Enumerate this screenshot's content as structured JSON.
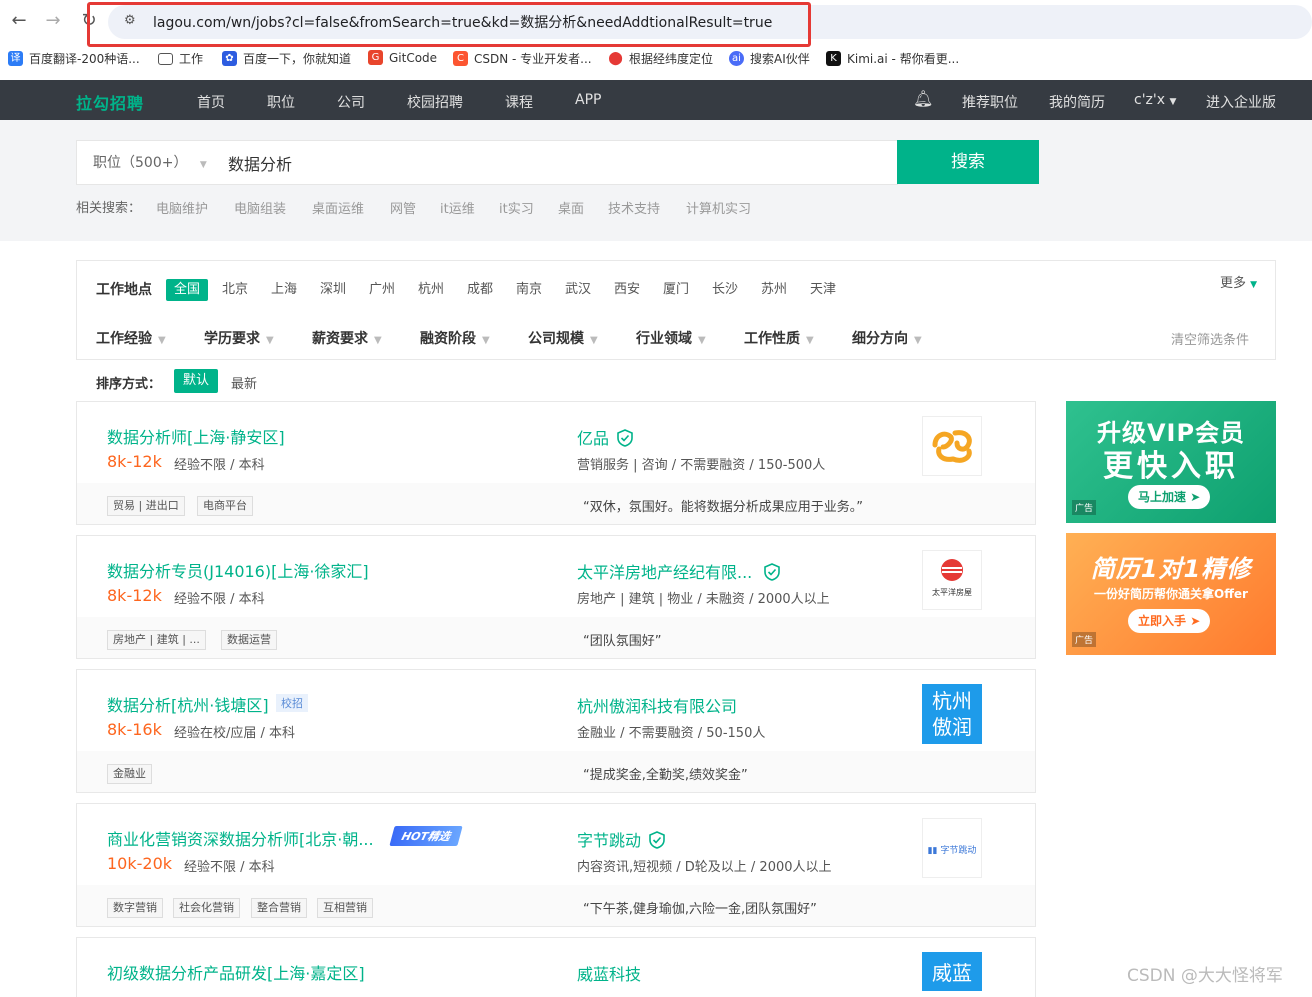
{
  "browser": {
    "url": "lagou.com/wn/jobs?cl=false&fromSearch=true&kd=数据分析&needAddtionalResult=true",
    "bookmarks": [
      "百度翻译-200种语...",
      "工作",
      "百度一下，你就知道",
      "GitCode",
      "CSDN - 专业开发者...",
      "根据经纬度定位",
      "搜索AI伙伴",
      "Kimi.ai - 帮你看更..."
    ]
  },
  "header": {
    "logo": "拉勾招聘",
    "nav": [
      "首页",
      "职位",
      "公司",
      "校园招聘",
      "课程",
      "APP"
    ],
    "right": [
      "推荐职位",
      "我的简历",
      "c'z'x",
      "进入企业版"
    ]
  },
  "search": {
    "category": "职位（500+）",
    "query": "数据分析",
    "button": "搜索",
    "related_label": "相关搜索：",
    "related": [
      "电脑维护",
      "电脑组装",
      "桌面运维",
      "网管",
      "it运维",
      "it实习",
      "桌面",
      "技术支持",
      "计算机实习"
    ]
  },
  "filters": {
    "location_label": "工作地点",
    "cities": [
      "全国",
      "北京",
      "上海",
      "深圳",
      "广州",
      "杭州",
      "成都",
      "南京",
      "武汉",
      "西安",
      "厦门",
      "长沙",
      "苏州",
      "天津"
    ],
    "more": "更多",
    "dropdowns": [
      "工作经验",
      "学历要求",
      "薪资要求",
      "融资阶段",
      "公司规模",
      "行业领域",
      "工作性质",
      "细分方向"
    ],
    "clear": "清空筛选条件"
  },
  "sort": {
    "label": "排序方式：",
    "default": "默认",
    "latest": "最新"
  },
  "jobs": [
    {
      "title": "数据分析师[上海·静安区]",
      "salary": "8k-12k",
      "req": "经验不限 / 本科",
      "company": "亿品",
      "industry": "营销服务 | 咨询 / 不需要融资 / 150-500人",
      "tags": [
        "贸易 | 进出口",
        "电商平台"
      ],
      "quote": "“双休，氛围好。能将数据分析成果应用于业务。”"
    },
    {
      "title": "数据分析专员(J14016)[上海·徐家汇]",
      "salary": "8k-12k",
      "req": "经验不限 / 本科",
      "company": "太平洋房地产经纪有限...",
      "industry": "房地产 | 建筑 | 物业 / 未融资 / 2000人以上",
      "tags": [
        "房地产 | 建筑 | ...",
        "数据运营"
      ],
      "quote": "“团队氛围好”",
      "logo_text": "太平洋房屋"
    },
    {
      "title": "数据分析[杭州·钱塘区]",
      "badge": "校招",
      "salary": "8k-16k",
      "req": "经验在校/应届 / 本科",
      "company": "杭州傲润科技有限公司",
      "industry": "金融业 / 不需要融资 / 50-150人",
      "tags": [
        "金融业"
      ],
      "quote": "“提成奖金,全勤奖,绩效奖金”",
      "logo_text": "杭州傲润"
    },
    {
      "title": "商业化营销资深数据分析师[北京·朝...",
      "badge": "HOT精选",
      "salary": "10k-20k",
      "req": "经验不限 / 本科",
      "company": "字节跳动",
      "industry": "内容资讯,短视频 / D轮及以上 / 2000人以上",
      "tags": [
        "数字营销",
        "社会化营销",
        "整合营销",
        "互相营销"
      ],
      "quote": "“下午茶,健身瑜伽,六险一金,团队氛围好”",
      "logo_text": "字节跳动"
    },
    {
      "title": "初级数据分析产品研发[上海·嘉定区]",
      "company": "威蓝科技",
      "logo_text": "威蓝"
    }
  ],
  "ads": [
    {
      "title": "升级VIP会员",
      "subtitle": "更快入职",
      "button": "马上加速",
      "tag": "广告"
    },
    {
      "title": "简历1对1精修",
      "subtitle": "一份好简历帮你通关拿Offer",
      "button": "立即入手",
      "tag": "广告"
    }
  ],
  "watermark": "CSDN @大大怪将军"
}
